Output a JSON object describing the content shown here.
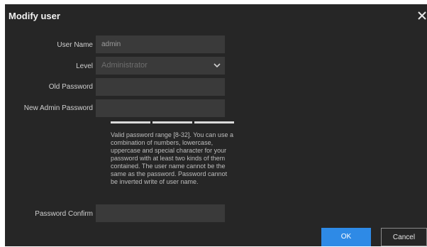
{
  "dialog": {
    "title": "Modify user"
  },
  "form": {
    "user_name": {
      "label": "User Name",
      "value": "admin"
    },
    "level": {
      "label": "Level",
      "value": "Administrator"
    },
    "old_password": {
      "label": "Old Password",
      "value": ""
    },
    "new_password": {
      "label": "New Admin Password",
      "value": ""
    },
    "password_confirm": {
      "label": "Password Confirm",
      "value": ""
    },
    "hint": "Valid password range [8-32]. You can use a combination of numbers, lowercase, uppercase and special character for your password with at least two kinds of them contained. The user name cannot be the same as the password. Password cannot be inverted write of user name."
  },
  "buttons": {
    "ok": "OK",
    "cancel": "Cancel"
  },
  "colors": {
    "dialog_bg": "#262626",
    "field_bg": "#3a3a3a",
    "accent": "#2e8ae6"
  },
  "icons": {
    "close": "close-icon",
    "dropdown": "chevron-down-icon"
  }
}
